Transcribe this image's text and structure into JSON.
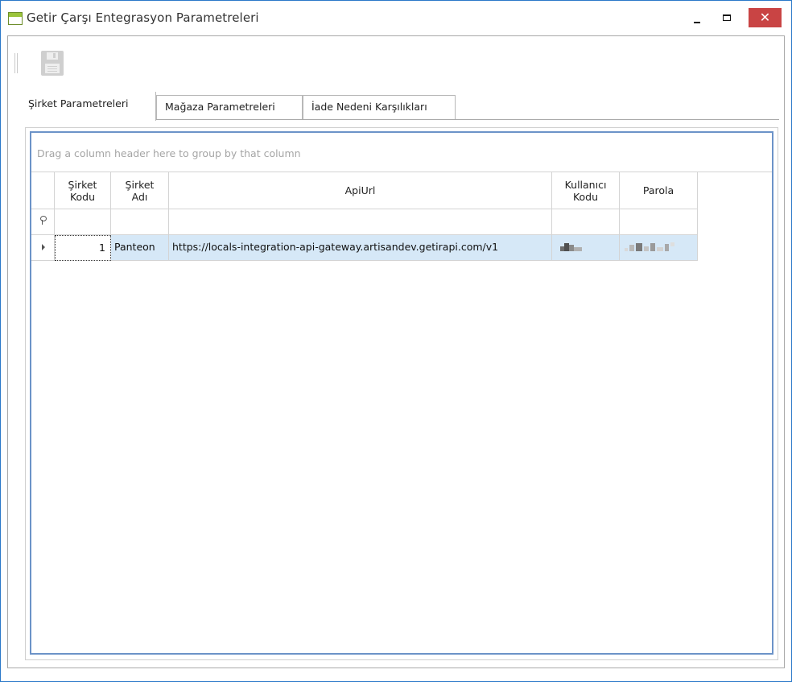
{
  "window": {
    "title": "Getir Çarşı Entegrasyon Parametreleri",
    "accent": "#2b79c9",
    "close_color": "#c94444",
    "close_glyph": "✕"
  },
  "toolbar": {
    "save_icon": "floppy-disk-icon",
    "save_enabled": false
  },
  "tabs": [
    {
      "label": "Şirket Parametreleri",
      "active": true
    },
    {
      "label": "Mağaza Parametreleri",
      "active": false
    },
    {
      "label": "İade Nedeni Karşılıkları",
      "active": false
    }
  ],
  "grid": {
    "group_panel_text": "Drag a column header here to group by that column",
    "columns": [
      {
        "label": "Şirket\nKodu"
      },
      {
        "label": "Şirket\nAdı"
      },
      {
        "label": "ApiUrl"
      },
      {
        "label": "Kullanıcı\nKodu"
      },
      {
        "label": "Parola"
      }
    ],
    "rows": [
      {
        "sirket_kodu": "1",
        "sirket_adi": "Panteon",
        "api_url": "https://locals-integration-api-gateway.artisandev.getirapi.com/v1",
        "kullanici_kodu": "(pixelated)",
        "parola": "(pixelated)"
      }
    ],
    "selected_row_color": "#d6e8f7",
    "border_color": "#6c93c8"
  }
}
